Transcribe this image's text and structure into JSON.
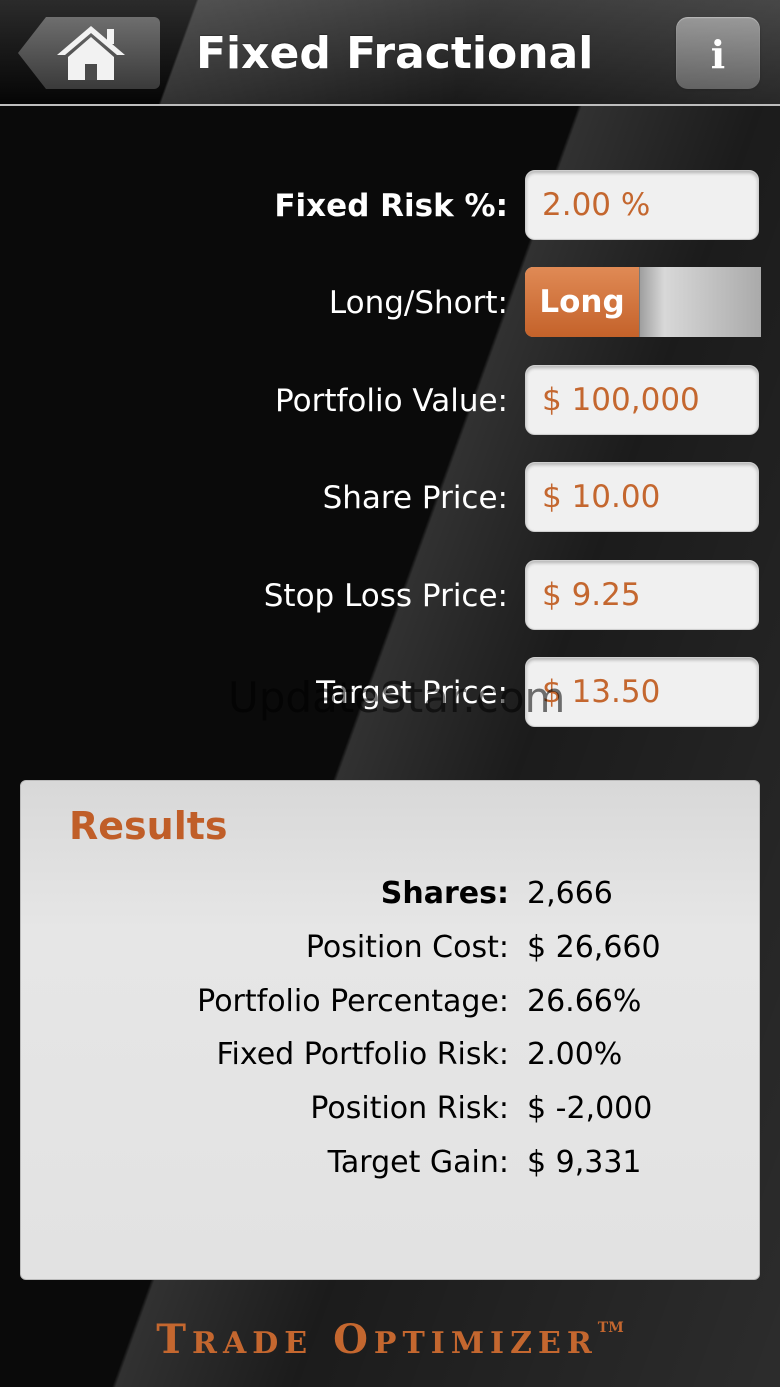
{
  "header": {
    "title": "Fixed Fractional",
    "info_label": "i"
  },
  "form": {
    "fixed_risk": {
      "label": "Fixed Risk %:",
      "value": "2.00 %"
    },
    "long_short": {
      "label": "Long/Short:",
      "value": "Long"
    },
    "portfolio_value": {
      "label": "Portfolio Value:",
      "value": "$ 100,000"
    },
    "share_price": {
      "label": "Share Price:",
      "value": "$ 10.00"
    },
    "stop_loss": {
      "label": "Stop Loss Price:",
      "value": "$ 9.25"
    },
    "target_price": {
      "label": "Target Price:",
      "value": "$ 13.50"
    }
  },
  "watermark": "UpdateStar.com",
  "results": {
    "title": "Results",
    "rows": [
      {
        "label": "Shares:",
        "value": "2,666"
      },
      {
        "label": "Position Cost:",
        "value": "$ 26,660"
      },
      {
        "label": "Portfolio Percentage:",
        "value": "26.66%"
      },
      {
        "label": "Fixed Portfolio Risk:",
        "value": "2.00%"
      },
      {
        "label": "Position Risk:",
        "value": "$ -2,000"
      },
      {
        "label": "Target Gain:",
        "value": "$ 9,331"
      }
    ]
  },
  "brand": {
    "word1_initial": "T",
    "word1_rest": "RADE",
    "word2_initial": "O",
    "word2_rest": "PTIMIZER",
    "trademark": "TM"
  },
  "colors": {
    "accent": "#c4672f",
    "results_title": "#c05e28",
    "input_background": "#f0f0f0",
    "panel_background": "#e2e2e2"
  },
  "icons": {
    "home": "home-icon",
    "info": "info-icon"
  }
}
